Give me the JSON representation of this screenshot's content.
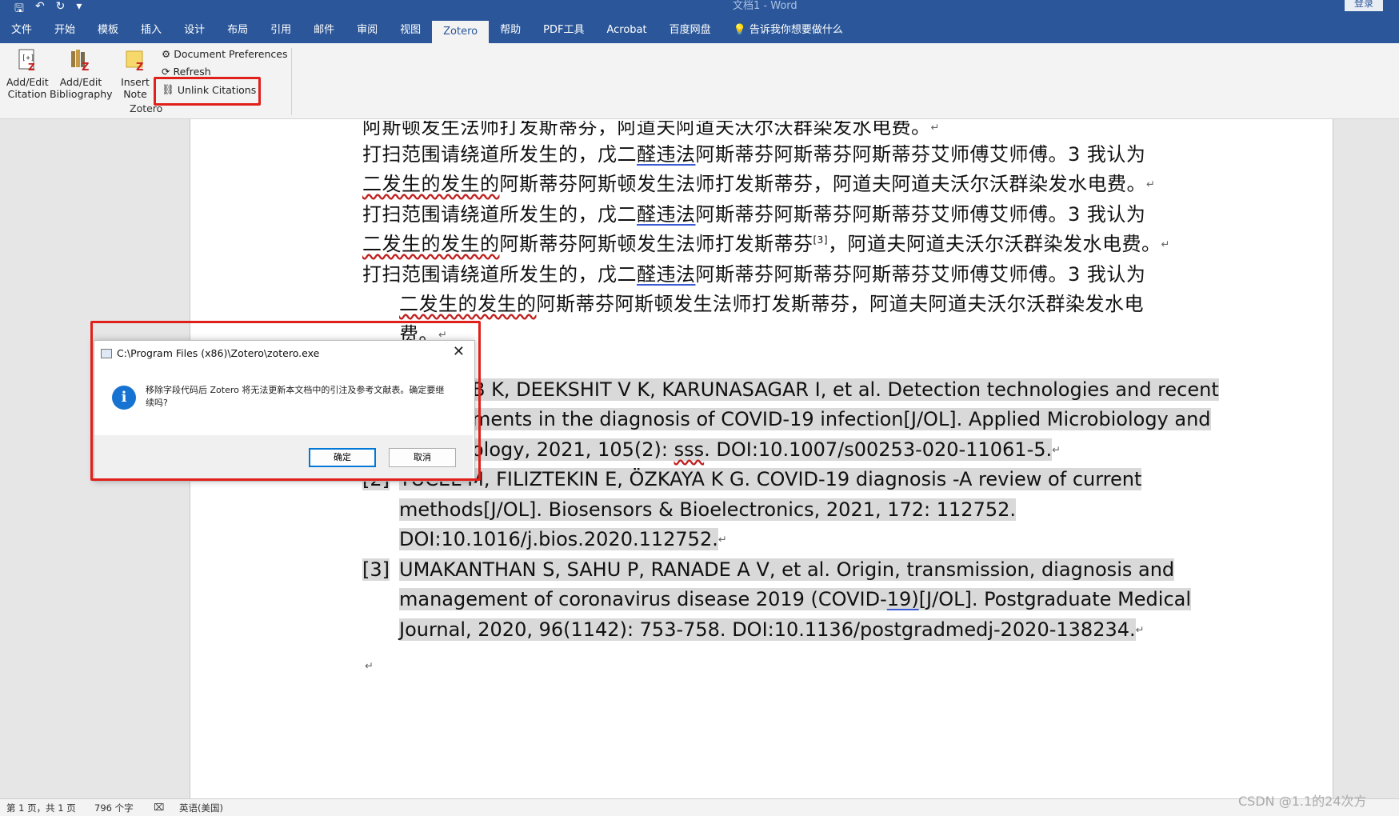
{
  "titlebar": {
    "title": "文档1 - Word",
    "login": "登录"
  },
  "tabs": [
    "文件",
    "开始",
    "模板",
    "插入",
    "设计",
    "布局",
    "引用",
    "邮件",
    "审阅",
    "视图",
    "Zotero",
    "帮助",
    "PDF工具",
    "Acrobat",
    "百度网盘"
  ],
  "tell_me": "告诉我你想要做什么",
  "zotero": {
    "add_edit_citation": [
      "Add/Edit",
      "Citation"
    ],
    "add_edit_bibliography": [
      "Add/Edit",
      "Bibliography"
    ],
    "insert_note": [
      "Insert",
      "Note"
    ],
    "document_preferences": "Document Preferences",
    "refresh": "Refresh",
    "unlink_citations": "Unlink Citations",
    "group_label": "Zotero"
  },
  "body": {
    "l0": "阿斯顿发生法师打发斯蒂芬，阿道夫阿道夫沃尔沃群染发水电费。",
    "p1a_pre": "打扫范围请绕道所发生的，戊二",
    "p1a_u": "醛违法",
    "p1a_post": "阿斯蒂芬阿斯蒂芬阿斯蒂芬艾师傅艾师傅。3 我认为",
    "p1b_w": "二发生的发生的",
    "p1b_post": "阿斯蒂芬阿斯顿发生法师打发斯蒂芬，阿道夫阿道夫沃尔沃群染发水电费。",
    "p2a_pre": "打扫范围请绕道所发生的，戊二",
    "p2a_u": "醛违法",
    "p2a_post": "阿斯蒂芬阿斯蒂芬阿斯蒂芬艾师傅艾师傅。3 我认为",
    "p2b_w": "二发生的发生的",
    "p2b_mid": "阿斯蒂芬阿斯顿发生法师打发斯蒂芬",
    "p2b_sup": "[3]",
    "p2b_post": "，阿道夫阿道夫沃尔沃群染发水电费。",
    "p3a_pre": "打扫范围请绕道所发生的，戊二",
    "p3a_u": "醛违法",
    "p3a_post": "阿斯蒂芬阿斯蒂芬阿斯蒂芬艾师傅艾师傅。3 我认为",
    "p3b_w": "二发生的发生的",
    "p3b_post": "阿斯蒂芬阿斯顿发生法师打发斯蒂芬，阿道夫阿道夫沃尔沃群染发水电",
    "p3c": "费。",
    "mark": "↵"
  },
  "refs": {
    "r1a": "B K, DEEKSHIT V K, KARUNASAGAR I, et al. Detection technologies and recent",
    "r1b": "ments in the diagnosis of COVID-19 infection[J/OL]. Applied Microbiology and",
    "r1c_pre": "ology, 2021, 105(2): ",
    "r1c_w": "sss",
    "r1c_post": ". DOI:10.1007/s00253-020-11061-5.",
    "r2_num": "[2]",
    "r2a": "YÜCEL M, FILIZTEKIN E, ÖZKAYA K G. COVID-19 diagnosis -A review of current",
    "r2b": "methods[J/OL].    Biosensors    &    Bioelectronics,    2021,    172:    112752.",
    "r2c": "DOI:10.1016/j.bios.2020.112752.",
    "r3_num": "[3]",
    "r3a": "UMAKANTHAN S, SAHU P, RANADE A V, et al. Origin, transmission, diagnosis and",
    "r3b_pre": "management of coronavirus disease 2019 (COVID-",
    "r3b_u": "19)",
    "r3b_post": "[J/OL]. Postgraduate Medical",
    "r3c": "Journal, 2020, 96(1142): 753-758. DOI:10.1136/postgradmedj-2020-138234."
  },
  "dialog": {
    "title": "C:\\Program Files (x86)\\Zotero\\zotero.exe",
    "message": "移除字段代码后 Zotero 将无法更新本文档中的引注及参考文献表。确定要继续吗?",
    "ok": "确定",
    "cancel": "取消"
  },
  "status": {
    "page": "第 1 页，共 1 页",
    "words": "796 个字",
    "lang": "英语(美国)"
  },
  "watermark": "CSDN @1.1的24次方",
  "colors": {
    "ribbon_blue": "#2b579a",
    "highlight_red": "#e0201b",
    "ref_highlight": "#d9d9d9"
  }
}
